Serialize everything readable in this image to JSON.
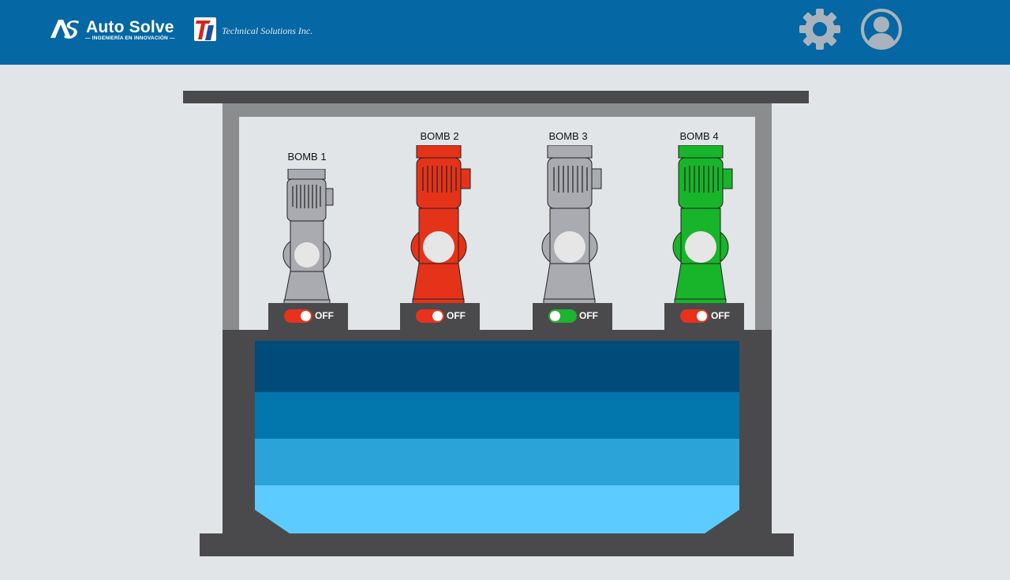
{
  "header": {
    "brand_name": "Auto Solve",
    "brand_tagline": "— INGENIERÍA EN INNOVACIÓN —",
    "brand_mark": "AS",
    "partner_name": "Technical Solutions Inc.",
    "partner_mark": "TI",
    "settings_icon": "gear-icon",
    "user_icon": "user-icon"
  },
  "colors": {
    "header": "#0567a4",
    "pump_off": "#a9abb0",
    "pump_red": "#e5331a",
    "pump_green": "#18b42a",
    "toggle_red": "#e8321c",
    "toggle_green": "#1db42e",
    "water_1": "#014b7a",
    "water_2": "#0277ad",
    "water_3": "#2ca3d8",
    "water_4": "#5ccbff"
  },
  "pumps": [
    {
      "label": "BOMB 1",
      "color": "#a9abb0",
      "toggle_color": "#e8321c",
      "toggle_on": true,
      "state": "OFF"
    },
    {
      "label": "BOMB 2",
      "color": "#e5331a",
      "toggle_color": "#e8321c",
      "toggle_on": true,
      "state": "OFF"
    },
    {
      "label": "BOMB 3",
      "color": "#a9abb0",
      "toggle_color": "#1db42e",
      "toggle_on": false,
      "state": "OFF"
    },
    {
      "label": "BOMB 4",
      "color": "#18b42a",
      "toggle_color": "#e8321c",
      "toggle_on": true,
      "state": "OFF"
    }
  ]
}
